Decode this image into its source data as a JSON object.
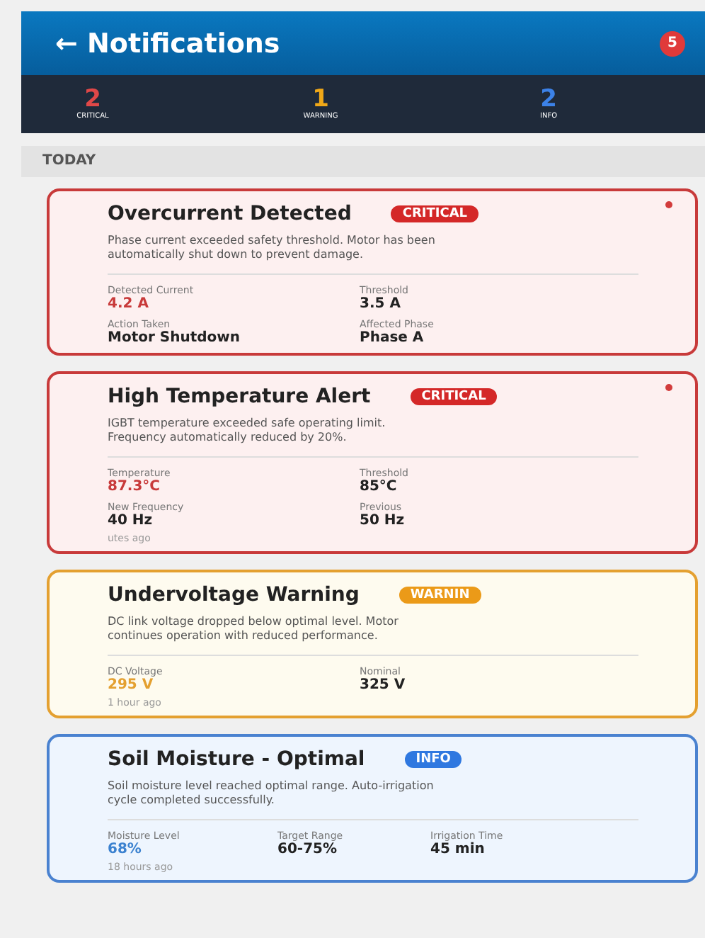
{
  "header": {
    "back": "←",
    "title": "Notifications",
    "count": "5"
  },
  "summary": [
    {
      "kind": "critical",
      "count": "2",
      "label": "CRITICAL"
    },
    {
      "kind": "warning",
      "count": "1",
      "label": "WARNING"
    },
    {
      "kind": "info",
      "count": "2",
      "label": "INFO"
    }
  ],
  "section": "TODAY",
  "notifications": [
    {
      "kind": "critical",
      "title": "Overcurrent Detected",
      "badge": "CRITICAL",
      "unread": true,
      "message": "Phase current exceeded safety threshold. Motor has been automatically shut down to prevent damage.",
      "fields": [
        {
          "label": "Detected Current",
          "value": "4.2 A",
          "highlight": true
        },
        {
          "label": "Threshold",
          "value": "3.5 A",
          "highlight": false
        },
        {
          "label": "Action Taken",
          "value": "Motor Shutdown",
          "highlight": false
        },
        {
          "label": "Affected Phase",
          "value": "Phase A",
          "highlight": false
        }
      ]
    },
    {
      "kind": "critical",
      "title": "High Temperature Alert",
      "badge": "CRITICAL",
      "unread": true,
      "message": "IGBT temperature exceeded safe operating limit. Frequency automatically reduced by 20%.",
      "fields": [
        {
          "label": "Temperature",
          "value": "87.3°C",
          "highlight": true
        },
        {
          "label": "Threshold",
          "value": "85°C",
          "highlight": false
        },
        {
          "label": "New Frequency",
          "value": "40 Hz",
          "highlight": false
        },
        {
          "label": "Previous",
          "value": "50 Hz",
          "highlight": false
        }
      ],
      "time": "utes ago"
    },
    {
      "kind": "warning",
      "title": "Undervoltage Warning",
      "badge": "WARNIN",
      "unread": false,
      "message": "DC link voltage dropped below optimal level. Motor continues operation with reduced performance.",
      "fields": [
        {
          "label": "DC Voltage",
          "value": "295 V",
          "highlight": true
        },
        {
          "label": "Nominal",
          "value": "325 V",
          "highlight": false
        }
      ],
      "time": "1 hour ago"
    },
    {
      "kind": "info",
      "title": "Soil Moisture - Optimal",
      "badge": "INFO",
      "unread": false,
      "message": "Soil moisture level reached optimal range. Auto-irrigation cycle completed successfully.",
      "fields": [
        {
          "label": "Moisture Level",
          "value": "68%",
          "highlight": true
        },
        {
          "label": "Target Range",
          "value": "60-75%",
          "highlight": false
        },
        {
          "label": "Irrigation Time",
          "value": "45 min",
          "highlight": false
        }
      ],
      "time": "18 hours ago"
    }
  ]
}
